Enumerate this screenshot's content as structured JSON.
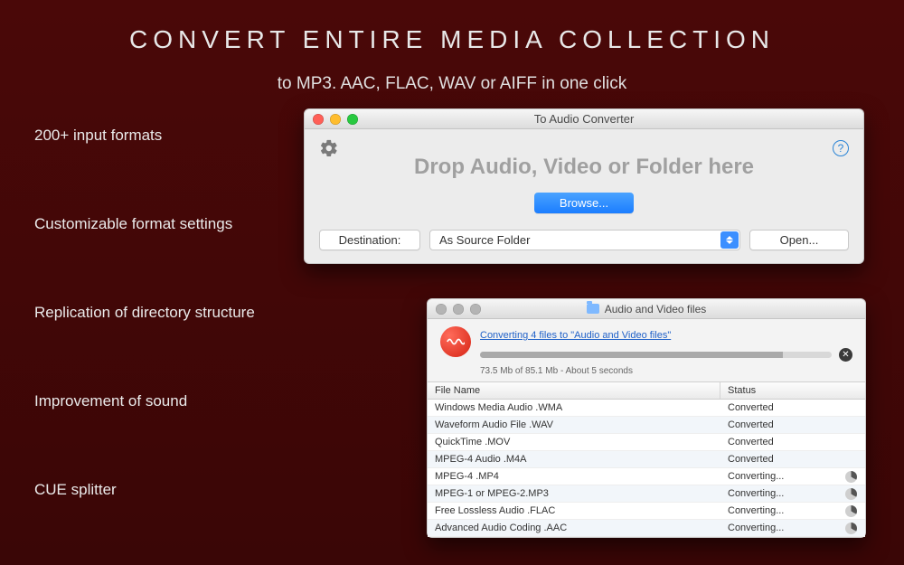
{
  "hero": {
    "title": "CONVERT  ENTIRE  MEDIA  COLLECTION",
    "subtitle": "to MP3. AAC, FLAC, WAV or AIFF in one click"
  },
  "features": [
    "200+ input formats",
    "Customizable format settings",
    "Replication of directory structure",
    "Improvement of sound",
    "CUE splitter"
  ],
  "window1": {
    "title": "To Audio Converter",
    "drop_label": "Drop Audio, Video or Folder here",
    "browse": "Browse...",
    "destination_label": "Destination:",
    "destination_value": "As Source Folder",
    "open": "Open...",
    "help": "?"
  },
  "window2": {
    "title": "Audio and Video files",
    "link": "Converting 4 files to \"Audio and Video files\"",
    "subtext": "73.5 Mb of 85.1 Mb - About 5 seconds",
    "columns": {
      "name": "File Name",
      "status": "Status"
    },
    "rows": [
      {
        "name": "Windows Media Audio .WMA",
        "status": "Converted",
        "busy": false
      },
      {
        "name": "Waveform Audio File .WAV",
        "status": "Converted",
        "busy": false
      },
      {
        "name": "QuickTime .MOV",
        "status": "Converted",
        "busy": false
      },
      {
        "name": "MPEG-4 Audio .M4A",
        "status": "Converted",
        "busy": false
      },
      {
        "name": "MPEG-4 .MP4",
        "status": "Converting...",
        "busy": true
      },
      {
        "name": "MPEG-1 or MPEG-2.MP3",
        "status": "Converting...",
        "busy": true
      },
      {
        "name": "Free Lossless Audio .FLAC",
        "status": "Converting...",
        "busy": true
      },
      {
        "name": "Advanced Audio Coding .AAC",
        "status": "Converting...",
        "busy": true
      }
    ]
  }
}
